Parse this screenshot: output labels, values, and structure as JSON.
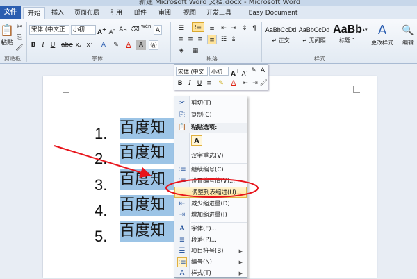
{
  "window": {
    "title": "新建 Microsoft Word 文档.docx - Microsoft Word"
  },
  "tabs": [
    "文件",
    "开始",
    "插入",
    "页面布局",
    "引用",
    "邮件",
    "审阅",
    "视图",
    "开发工具",
    "Easy Document Creator"
  ],
  "ribbon": {
    "clipboard": {
      "paste_label": "粘贴",
      "group_label": "剪贴板"
    },
    "font": {
      "font_name": "宋体 (中文正",
      "font_size": "小初",
      "group_label": "字体",
      "wen": "wén",
      "char_a": "A"
    },
    "paragraph": {
      "group_label": "段落"
    },
    "styles": {
      "group_label": "样式",
      "items": [
        {
          "preview": "AaBbCcDd",
          "name": "↵ 正文"
        },
        {
          "preview": "AaBbCcDd",
          "name": "↵ 无间隔"
        },
        {
          "preview": "AaBb",
          "name": "标题 1"
        }
      ],
      "change_label": "更改样式"
    },
    "editing": {
      "label": "编辑"
    }
  },
  "document": {
    "list_items": [
      {
        "number": "1.",
        "text": "百度知"
      },
      {
        "number": "2.",
        "text": "百度知"
      },
      {
        "number": "3.",
        "text": "百度知"
      },
      {
        "number": "4.",
        "text": "百度知"
      },
      {
        "number": "5.",
        "text": "百度知"
      }
    ]
  },
  "mini_toolbar": {
    "font_name": "宋体 (中文",
    "font_size": "小初",
    "bold": "B",
    "italic": "I",
    "underline": "U"
  },
  "context_menu": {
    "cut": "剪切(T)",
    "copy": "复制(C)",
    "paste_options": "粘贴选项:",
    "paste_keep": "A",
    "reconvert": "汉字重选(V)",
    "continue_numbering": "继续编号(C)",
    "set_numbering_value": "设置编号值(V)...",
    "adjust_list_indent": "调整列表缩进(U)...",
    "decrease_indent": "减少缩进量(D)",
    "increase_indent": "增加缩进量(I)",
    "font": "字体(F)...",
    "paragraph": "段落(P)...",
    "bullets": "项目符号(B)",
    "numbering": "编号(N)",
    "styles": "样式(T)"
  },
  "colors": {
    "highlight": "#9cc4e6",
    "annotation": "#e8141b",
    "file_tab": "#2a5db0",
    "menu_hover": "#ffe39a"
  }
}
